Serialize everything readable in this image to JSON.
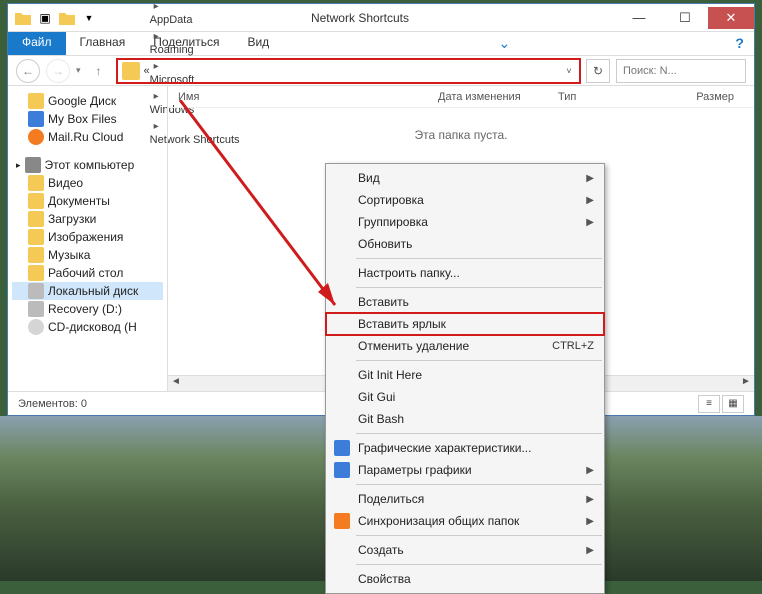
{
  "titlebar": {
    "title": "Network Shortcuts"
  },
  "ribbon": {
    "file": "Файл",
    "home": "Главная",
    "share": "Поделиться",
    "view": "Вид"
  },
  "breadcrumb": {
    "prefix": "«",
    "segs": [
      "AppData",
      "Roaming",
      "Microsoft",
      "Windows",
      "Network Shortcuts"
    ]
  },
  "search": {
    "placeholder": "Поиск: N..."
  },
  "columns": {
    "name": "Имя",
    "date": "Дата изменения",
    "type": "Тип",
    "size": "Размер"
  },
  "empty_msg": "Эта папка пуста.",
  "statusbar": {
    "count": "Элементов: 0"
  },
  "sidebar": {
    "fav": [
      {
        "label": "Google Диск",
        "ico": "yel"
      },
      {
        "label": "My Box Files",
        "ico": "blue"
      },
      {
        "label": "Mail.Ru Cloud",
        "ico": "orange"
      }
    ],
    "pc_label": "Этот компьютер",
    "pc": [
      "Видео",
      "Документы",
      "Загрузки",
      "Изображения",
      "Музыка",
      "Рабочий стол",
      "Локальный диск",
      "Recovery (D:)",
      "CD-дисковод (H"
    ]
  },
  "ctx": {
    "items": [
      {
        "label": "Вид",
        "submenu": true
      },
      {
        "label": "Сортировка",
        "submenu": true
      },
      {
        "label": "Группировка",
        "submenu": true
      },
      {
        "label": "Обновить"
      },
      {
        "sep": true
      },
      {
        "label": "Настроить папку..."
      },
      {
        "sep": true
      },
      {
        "label": "Вставить"
      },
      {
        "label": "Вставить ярлык",
        "highlight": true
      },
      {
        "label": "Отменить удаление",
        "shortcut": "CTRL+Z"
      },
      {
        "sep": true
      },
      {
        "label": "Git Init Here"
      },
      {
        "label": "Git Gui"
      },
      {
        "label": "Git Bash"
      },
      {
        "sep": true
      },
      {
        "label": "Графические характеристики...",
        "icon": "intel"
      },
      {
        "label": "Параметры графики",
        "submenu": true,
        "icon": "intel"
      },
      {
        "sep": true
      },
      {
        "label": "Поделиться",
        "submenu": true
      },
      {
        "label": "Синхронизация общих папок",
        "submenu": true,
        "icon": "sync"
      },
      {
        "sep": true
      },
      {
        "label": "Создать",
        "submenu": true
      },
      {
        "sep": true
      },
      {
        "label": "Свойства"
      }
    ]
  }
}
